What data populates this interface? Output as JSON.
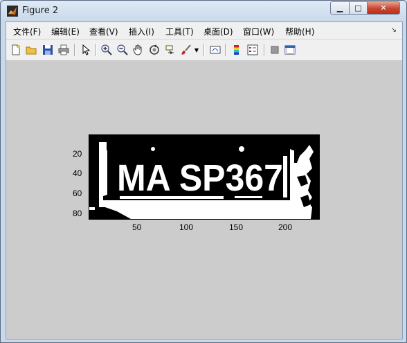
{
  "window": {
    "title": "Figure 2"
  },
  "menu": {
    "items": [
      "文件(F)",
      "编辑(E)",
      "查看(V)",
      "插入(I)",
      "工具(T)",
      "桌面(D)",
      "窗口(W)",
      "帮助(H)"
    ]
  },
  "toolbar": {
    "buttons": [
      "new-figure",
      "open-file",
      "save",
      "print",
      "edit-plot",
      "zoom-in",
      "zoom-out",
      "pan",
      "rotate-3d",
      "data-cursor",
      "brush",
      "brush-dropdown",
      "link-plot",
      "colorbar",
      "legend",
      "hide-plot-tools",
      "show-plot-tools"
    ]
  },
  "axes": {
    "y_ticks": [
      "20",
      "40",
      "60",
      "80"
    ],
    "x_ticks": [
      "50",
      "100",
      "150",
      "200"
    ]
  },
  "image": {
    "plate_text": "MA SP367",
    "colors": {
      "foreground": "#ffffff",
      "background": "#000000"
    }
  }
}
